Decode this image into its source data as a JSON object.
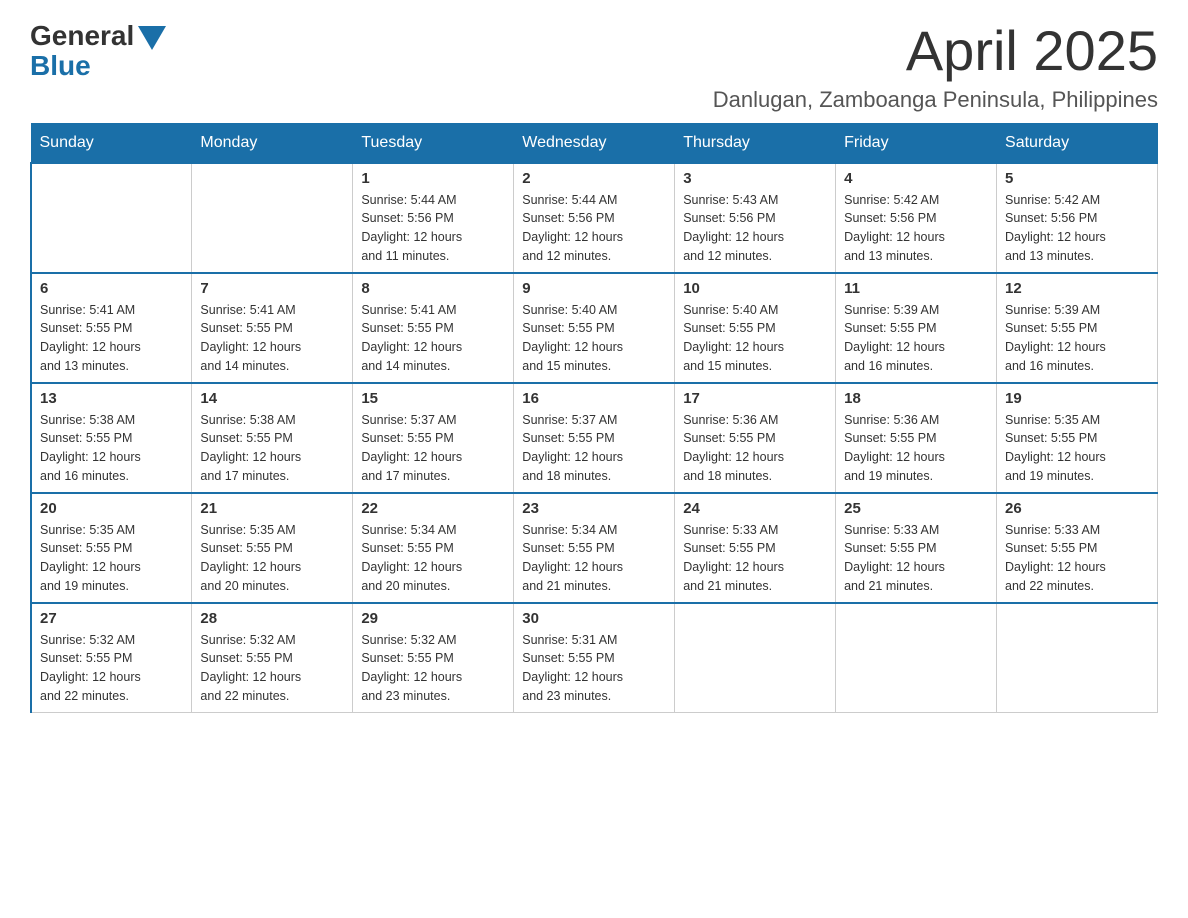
{
  "logo": {
    "general": "General",
    "blue": "Blue"
  },
  "title": "April 2025",
  "location": "Danlugan, Zamboanga Peninsula, Philippines",
  "weekdays": [
    "Sunday",
    "Monday",
    "Tuesday",
    "Wednesday",
    "Thursday",
    "Friday",
    "Saturday"
  ],
  "weeks": [
    [
      {
        "day": "",
        "info": ""
      },
      {
        "day": "",
        "info": ""
      },
      {
        "day": "1",
        "info": "Sunrise: 5:44 AM\nSunset: 5:56 PM\nDaylight: 12 hours\nand 11 minutes."
      },
      {
        "day": "2",
        "info": "Sunrise: 5:44 AM\nSunset: 5:56 PM\nDaylight: 12 hours\nand 12 minutes."
      },
      {
        "day": "3",
        "info": "Sunrise: 5:43 AM\nSunset: 5:56 PM\nDaylight: 12 hours\nand 12 minutes."
      },
      {
        "day": "4",
        "info": "Sunrise: 5:42 AM\nSunset: 5:56 PM\nDaylight: 12 hours\nand 13 minutes."
      },
      {
        "day": "5",
        "info": "Sunrise: 5:42 AM\nSunset: 5:56 PM\nDaylight: 12 hours\nand 13 minutes."
      }
    ],
    [
      {
        "day": "6",
        "info": "Sunrise: 5:41 AM\nSunset: 5:55 PM\nDaylight: 12 hours\nand 13 minutes."
      },
      {
        "day": "7",
        "info": "Sunrise: 5:41 AM\nSunset: 5:55 PM\nDaylight: 12 hours\nand 14 minutes."
      },
      {
        "day": "8",
        "info": "Sunrise: 5:41 AM\nSunset: 5:55 PM\nDaylight: 12 hours\nand 14 minutes."
      },
      {
        "day": "9",
        "info": "Sunrise: 5:40 AM\nSunset: 5:55 PM\nDaylight: 12 hours\nand 15 minutes."
      },
      {
        "day": "10",
        "info": "Sunrise: 5:40 AM\nSunset: 5:55 PM\nDaylight: 12 hours\nand 15 minutes."
      },
      {
        "day": "11",
        "info": "Sunrise: 5:39 AM\nSunset: 5:55 PM\nDaylight: 12 hours\nand 16 minutes."
      },
      {
        "day": "12",
        "info": "Sunrise: 5:39 AM\nSunset: 5:55 PM\nDaylight: 12 hours\nand 16 minutes."
      }
    ],
    [
      {
        "day": "13",
        "info": "Sunrise: 5:38 AM\nSunset: 5:55 PM\nDaylight: 12 hours\nand 16 minutes."
      },
      {
        "day": "14",
        "info": "Sunrise: 5:38 AM\nSunset: 5:55 PM\nDaylight: 12 hours\nand 17 minutes."
      },
      {
        "day": "15",
        "info": "Sunrise: 5:37 AM\nSunset: 5:55 PM\nDaylight: 12 hours\nand 17 minutes."
      },
      {
        "day": "16",
        "info": "Sunrise: 5:37 AM\nSunset: 5:55 PM\nDaylight: 12 hours\nand 18 minutes."
      },
      {
        "day": "17",
        "info": "Sunrise: 5:36 AM\nSunset: 5:55 PM\nDaylight: 12 hours\nand 18 minutes."
      },
      {
        "day": "18",
        "info": "Sunrise: 5:36 AM\nSunset: 5:55 PM\nDaylight: 12 hours\nand 19 minutes."
      },
      {
        "day": "19",
        "info": "Sunrise: 5:35 AM\nSunset: 5:55 PM\nDaylight: 12 hours\nand 19 minutes."
      }
    ],
    [
      {
        "day": "20",
        "info": "Sunrise: 5:35 AM\nSunset: 5:55 PM\nDaylight: 12 hours\nand 19 minutes."
      },
      {
        "day": "21",
        "info": "Sunrise: 5:35 AM\nSunset: 5:55 PM\nDaylight: 12 hours\nand 20 minutes."
      },
      {
        "day": "22",
        "info": "Sunrise: 5:34 AM\nSunset: 5:55 PM\nDaylight: 12 hours\nand 20 minutes."
      },
      {
        "day": "23",
        "info": "Sunrise: 5:34 AM\nSunset: 5:55 PM\nDaylight: 12 hours\nand 21 minutes."
      },
      {
        "day": "24",
        "info": "Sunrise: 5:33 AM\nSunset: 5:55 PM\nDaylight: 12 hours\nand 21 minutes."
      },
      {
        "day": "25",
        "info": "Sunrise: 5:33 AM\nSunset: 5:55 PM\nDaylight: 12 hours\nand 21 minutes."
      },
      {
        "day": "26",
        "info": "Sunrise: 5:33 AM\nSunset: 5:55 PM\nDaylight: 12 hours\nand 22 minutes."
      }
    ],
    [
      {
        "day": "27",
        "info": "Sunrise: 5:32 AM\nSunset: 5:55 PM\nDaylight: 12 hours\nand 22 minutes."
      },
      {
        "day": "28",
        "info": "Sunrise: 5:32 AM\nSunset: 5:55 PM\nDaylight: 12 hours\nand 22 minutes."
      },
      {
        "day": "29",
        "info": "Sunrise: 5:32 AM\nSunset: 5:55 PM\nDaylight: 12 hours\nand 23 minutes."
      },
      {
        "day": "30",
        "info": "Sunrise: 5:31 AM\nSunset: 5:55 PM\nDaylight: 12 hours\nand 23 minutes."
      },
      {
        "day": "",
        "info": ""
      },
      {
        "day": "",
        "info": ""
      },
      {
        "day": "",
        "info": ""
      }
    ]
  ]
}
